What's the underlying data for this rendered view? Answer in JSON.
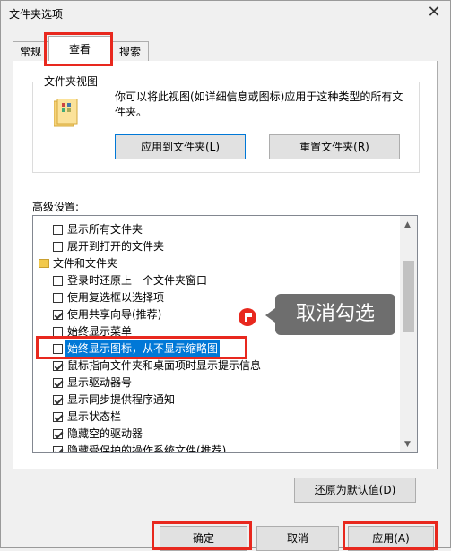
{
  "window": {
    "title": "文件夹选项",
    "close_glyph": "✕"
  },
  "tabs": [
    {
      "label": "常规"
    },
    {
      "label": "查看"
    },
    {
      "label": "搜索"
    }
  ],
  "folder_views": {
    "group_title": "文件夹视图",
    "description": "你可以将此视图(如详细信息或图标)应用于这种类型的所有文件夹。",
    "apply_button": "应用到文件夹(L)",
    "reset_button": "重置文件夹(R)"
  },
  "advanced": {
    "label": "高级设置:",
    "items": [
      {
        "label": "显示所有文件夹",
        "checked": false,
        "type": "checkbox"
      },
      {
        "label": "展开到打开的文件夹",
        "checked": false,
        "type": "checkbox"
      },
      {
        "label": "文件和文件夹",
        "type": "folder"
      },
      {
        "label": "登录时还原上一个文件夹窗口",
        "checked": false,
        "type": "checkbox"
      },
      {
        "label": "使用复选框以选择项",
        "checked": false,
        "type": "checkbox"
      },
      {
        "label": "使用共享向导(推荐)",
        "checked": true,
        "type": "checkbox"
      },
      {
        "label": "始终显示菜单",
        "checked": false,
        "type": "checkbox"
      },
      {
        "label": "始终显示图标，从不显示缩略图",
        "checked": false,
        "type": "checkbox",
        "selected": true
      },
      {
        "label": "鼠标指向文件夹和桌面项时显示提示信息",
        "checked": true,
        "type": "checkbox"
      },
      {
        "label": "显示驱动器号",
        "checked": true,
        "type": "checkbox"
      },
      {
        "label": "显示同步提供程序通知",
        "checked": true,
        "type": "checkbox"
      },
      {
        "label": "显示状态栏",
        "checked": true,
        "type": "checkbox"
      },
      {
        "label": "隐藏空的驱动器",
        "checked": true,
        "type": "checkbox"
      },
      {
        "label": "隐藏受保护的操作系统文件(推荐)",
        "checked": true,
        "type": "checkbox"
      }
    ],
    "restore_button": "还原为默认值(D)"
  },
  "annotation": {
    "tip_text": "取消勾选"
  },
  "footer": {
    "ok_button": "确定",
    "cancel_button": "取消",
    "apply_button": "应用(A)"
  },
  "colors": {
    "highlight": "#e8281e",
    "selection": "#0078d7",
    "tooltip": "#6e6e6e"
  }
}
